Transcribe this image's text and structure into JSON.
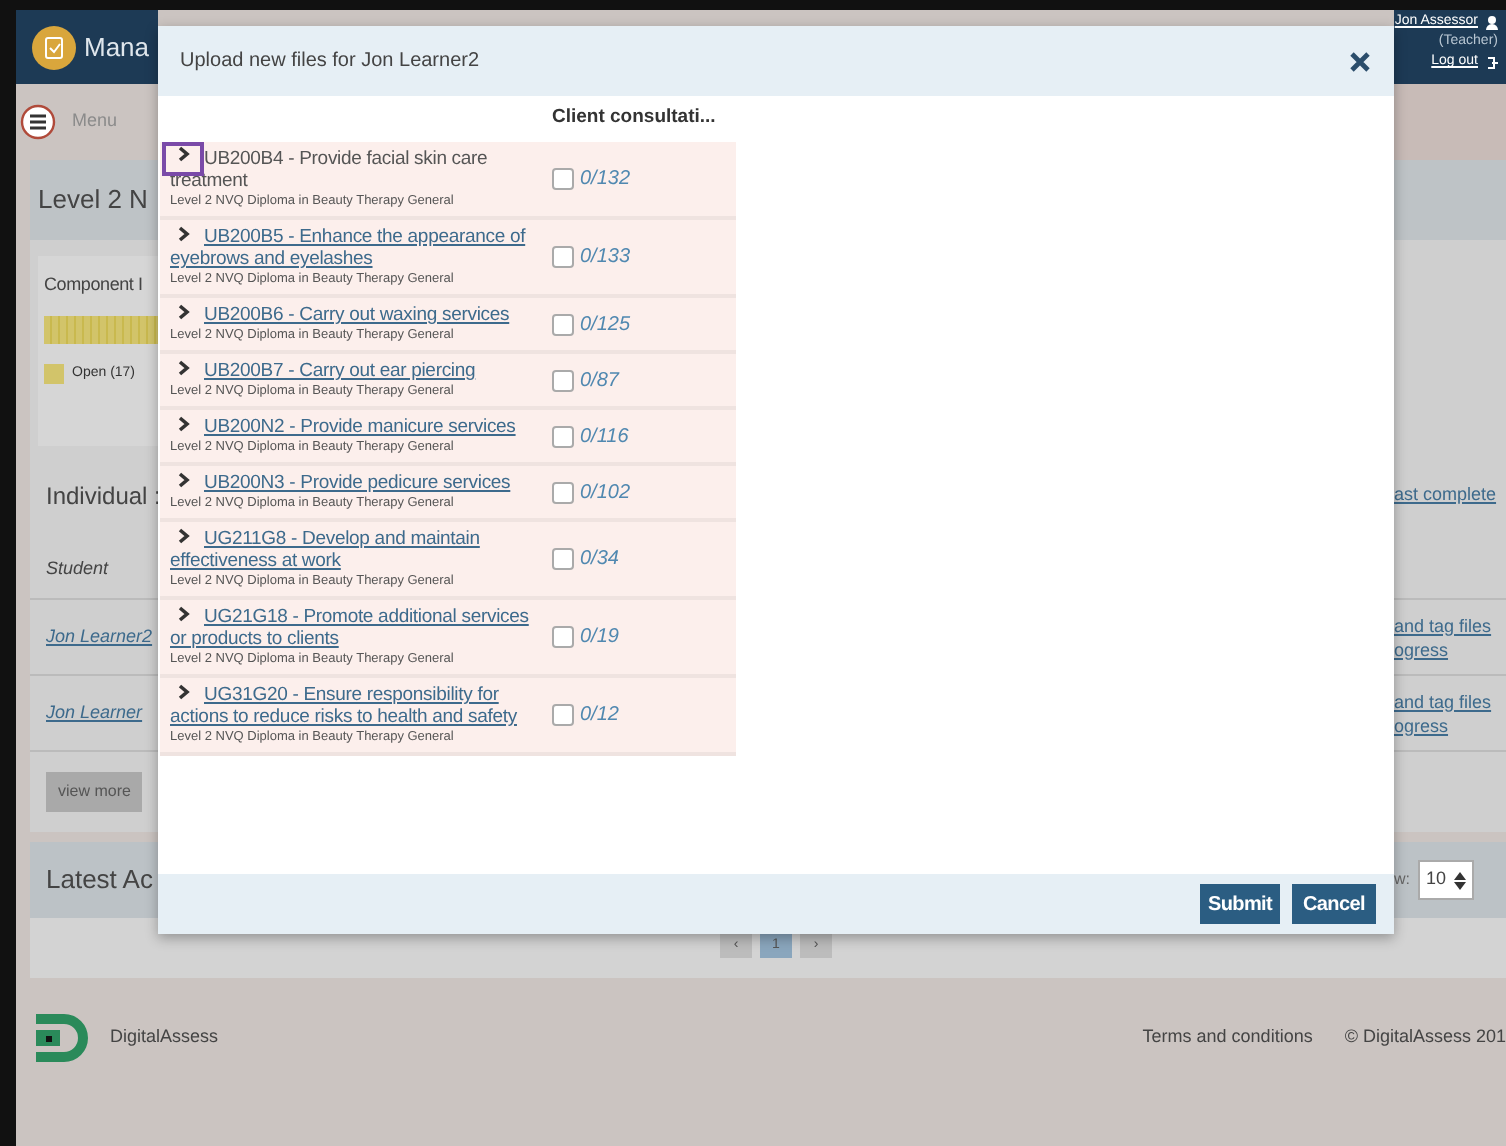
{
  "navbar": {
    "brand": "Mana",
    "user": "Jon Assessor",
    "role": "(Teacher)",
    "logout": "Log out"
  },
  "menu": {
    "label": "Menu"
  },
  "page": {
    "title": "Level 2 N",
    "component_label": "Component I",
    "open_label": "Open (17)",
    "individual_label": "Individual :",
    "last_complete": "ast complete",
    "student_header": "Student",
    "learners": [
      {
        "name": "Jon Learner2",
        "action": [
          "and tag files",
          "ogress"
        ]
      },
      {
        "name": "Jon Learner",
        "action": [
          "and tag files",
          "ogress"
        ]
      }
    ],
    "view_more": "view more",
    "latest_label": "Latest Ac",
    "show_label": "w:",
    "page_size": "10",
    "pagination": [
      "‹",
      "1",
      "›"
    ]
  },
  "footer": {
    "brand": "DigitalAssess",
    "terms": "Terms and conditions",
    "copyright": "© DigitalAssess 201"
  },
  "modal": {
    "title": "Upload new files for Jon Learner2",
    "column": "Client consultati...",
    "rows": [
      {
        "title": "UB200B4 - Provide facial skin care treatment",
        "subtitle": "Level 2 NVQ Diploma in Beauty Therapy General",
        "checked": false,
        "count": "0/132",
        "focused": true
      },
      {
        "title": "UB200B5 - Enhance the appearance of eyebrows and eyelashes",
        "subtitle": "Level 2 NVQ Diploma in Beauty Therapy General",
        "checked": false,
        "count": "0/133",
        "focused": false
      },
      {
        "title": "UB200B6 - Carry out waxing services",
        "subtitle": "Level 2 NVQ Diploma in Beauty Therapy General",
        "checked": false,
        "count": "0/125",
        "focused": false
      },
      {
        "title": "UB200B7 - Carry out ear piercing",
        "subtitle": "Level 2 NVQ Diploma in Beauty Therapy General",
        "checked": false,
        "count": "0/87",
        "focused": false
      },
      {
        "title": "UB200N2 - Provide manicure services",
        "subtitle": "Level 2 NVQ Diploma in Beauty Therapy General",
        "checked": false,
        "count": "0/116",
        "focused": false
      },
      {
        "title": "UB200N3 - Provide pedicure services",
        "subtitle": "Level 2 NVQ Diploma in Beauty Therapy General",
        "checked": false,
        "count": "0/102",
        "focused": false
      },
      {
        "title": "UG211G8 - Develop and maintain effectiveness at work",
        "subtitle": "Level 2 NVQ Diploma in Beauty Therapy General",
        "checked": false,
        "count": "0/34",
        "focused": false
      },
      {
        "title": "UG21G18 - Promote additional services or products to clients",
        "subtitle": "Level 2 NVQ Diploma in Beauty Therapy General",
        "checked": false,
        "count": "0/19",
        "focused": false
      },
      {
        "title": "UG31G20 - Ensure responsibility for actions to reduce risks to health and safety",
        "subtitle": "Level 2 NVQ Diploma in Beauty Therapy General",
        "checked": false,
        "count": "0/12",
        "focused": false
      }
    ],
    "buttons": [
      "Submit",
      "Cancel"
    ]
  }
}
